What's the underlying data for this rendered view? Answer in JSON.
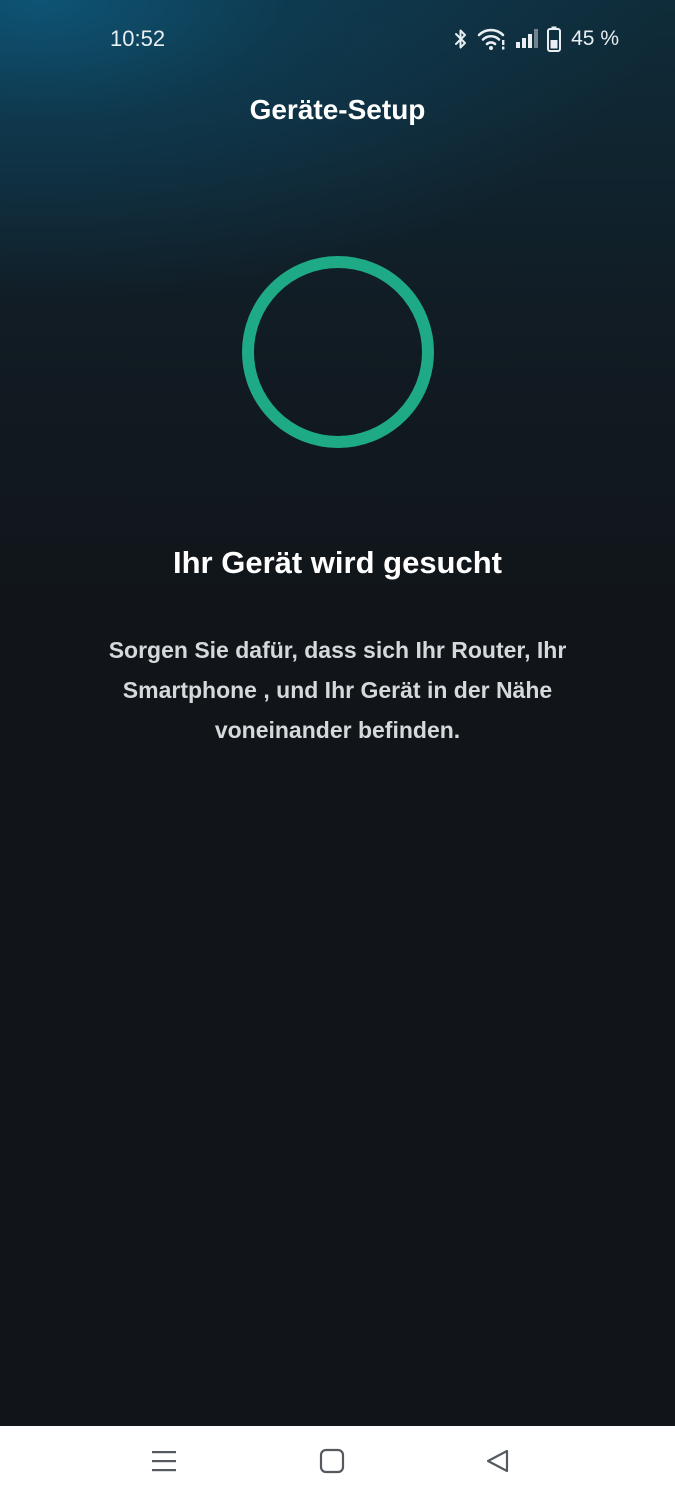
{
  "status_bar": {
    "time": "10:52",
    "battery_percent": "45 %",
    "icons": [
      "bluetooth-icon",
      "wifi-icon",
      "signal-icon",
      "battery-icon"
    ]
  },
  "header": {
    "title": "Geräte-Setup"
  },
  "main": {
    "spinner_color": "#1faa86",
    "heading": "Ihr Gerät wird gesucht",
    "description": "Sorgen Sie dafür, dass sich Ihr Router, Ihr Smartphone , und Ihr Gerät in der Nähe voneinander befinden."
  },
  "nav_bar": {
    "buttons": [
      "menu-icon",
      "home-icon",
      "back-icon"
    ]
  },
  "colors": {
    "accent": "#1faa86",
    "background": "#111418",
    "nav_background": "#ffffff"
  }
}
